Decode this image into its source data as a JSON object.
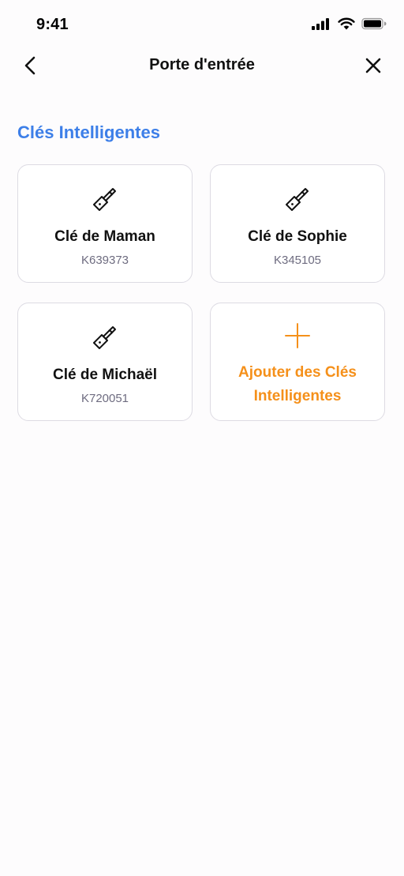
{
  "status_bar": {
    "time": "9:41"
  },
  "nav": {
    "title": "Porte d'entrée",
    "back_icon": "chevron-left-icon",
    "close_icon": "close-icon"
  },
  "section": {
    "title": "Clés Intelligentes"
  },
  "keys": [
    {
      "name": "Clé de Maman",
      "code": "K639373",
      "icon": "key-icon"
    },
    {
      "name": "Clé de Sophie",
      "code": "K345105",
      "icon": "key-icon"
    },
    {
      "name": "Clé de Michaël",
      "code": "K720051",
      "icon": "key-icon"
    }
  ],
  "add_card": {
    "label": "Ajouter des Clés Intelligentes",
    "icon": "plus-icon"
  },
  "colors": {
    "accent_blue": "#3d7fe8",
    "accent_orange": "#f5901a",
    "code_gray": "#6e6c80",
    "card_border": "#dddbe3",
    "background": "#fdfcfd"
  }
}
